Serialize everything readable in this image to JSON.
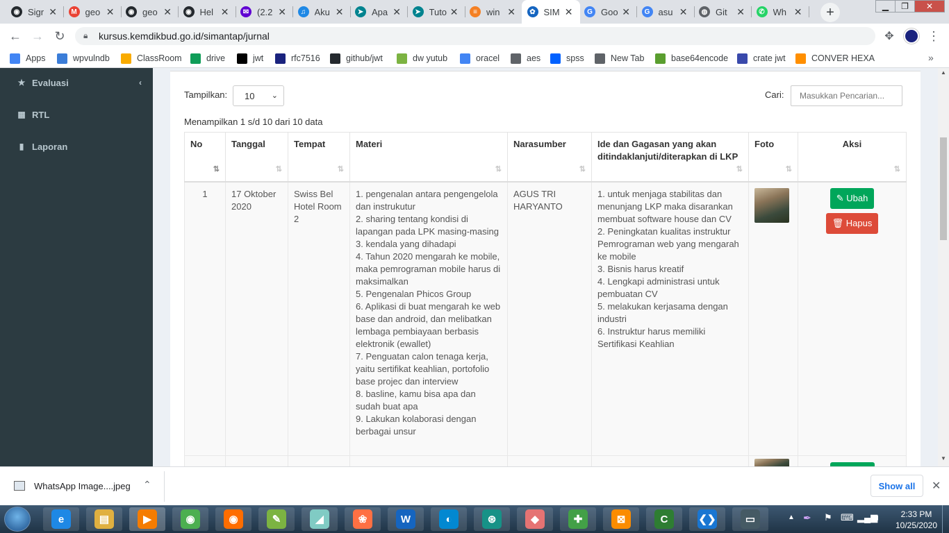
{
  "browser": {
    "tabs": [
      {
        "title": "Sigr",
        "icon": "github-icon",
        "color": "#24292e",
        "glyph": "◉"
      },
      {
        "title": "geo",
        "icon": "gmail-icon",
        "color": "#ea4335",
        "glyph": "M"
      },
      {
        "title": "geo",
        "icon": "github-icon",
        "color": "#24292e",
        "glyph": "◉"
      },
      {
        "title": "Hel",
        "icon": "github-icon",
        "color": "#24292e",
        "glyph": "◉"
      },
      {
        "title": "(2.2",
        "icon": "yahoo-mail-icon",
        "color": "#6001d2",
        "glyph": "✉"
      },
      {
        "title": "Aku",
        "icon": "document-icon",
        "color": "#1e88e5",
        "glyph": "♫"
      },
      {
        "title": "Apa",
        "icon": "web-icon",
        "color": "#00838f",
        "glyph": "➤"
      },
      {
        "title": "Tuto",
        "icon": "web-icon",
        "color": "#00838f",
        "glyph": "➤"
      },
      {
        "title": "win",
        "icon": "stackoverflow-icon",
        "color": "#f48024",
        "glyph": "≡"
      },
      {
        "title": "SIM",
        "icon": "kemdikbud-icon",
        "color": "#1565c0",
        "glyph": "✿",
        "active": true
      },
      {
        "title": "Goo",
        "icon": "google-docs-icon",
        "color": "#4285f4",
        "glyph": "G"
      },
      {
        "title": "asu",
        "icon": "google-icon",
        "color": "#4285f4",
        "glyph": "G"
      },
      {
        "title": "Git",
        "icon": "globe-icon",
        "color": "#5f6368",
        "glyph": "◍"
      },
      {
        "title": "Wh",
        "icon": "whatsapp-icon",
        "color": "#25d366",
        "glyph": "✆"
      }
    ],
    "url": "kursus.kemdikbud.go.id/simantap/jurnal",
    "bookmarks": [
      {
        "label": "Apps",
        "icon": "apps-grid-icon",
        "color": "#4285f4"
      },
      {
        "label": "wpvulndb",
        "icon": "wpvulndb-icon",
        "color": "#3b7dd8"
      },
      {
        "label": "ClassRoom",
        "icon": "classroom-icon",
        "color": "#f9ab00"
      },
      {
        "label": "drive",
        "icon": "drive-icon",
        "color": "#0f9d58"
      },
      {
        "label": "jwt",
        "icon": "jwt-icon",
        "color": "#000000"
      },
      {
        "label": "rfc7516",
        "icon": "rfc-icon",
        "color": "#1a237e"
      },
      {
        "label": "github/jwt",
        "icon": "github-icon",
        "color": "#24292e"
      },
      {
        "label": "dw yutub",
        "icon": "download-arrow-icon",
        "color": "#7cb342"
      },
      {
        "label": "oracel",
        "icon": "document-icon",
        "color": "#4285f4"
      },
      {
        "label": "aes",
        "icon": "globe-icon",
        "color": "#5f6368"
      },
      {
        "label": "spss",
        "icon": "dropbox-icon",
        "color": "#0061ff"
      },
      {
        "label": "New Tab",
        "icon": "globe-icon",
        "color": "#5f6368"
      },
      {
        "label": "base64encode",
        "icon": "b64-icon",
        "color": "#5a9e2f"
      },
      {
        "label": "crate jwt",
        "icon": "jwt-icon",
        "color": "#3949ab"
      },
      {
        "label": "CONVER HEXA",
        "icon": "hexa-icon",
        "color": "#ff8f00"
      }
    ]
  },
  "sidebar": {
    "items": [
      {
        "label": "Evaluasi",
        "icon": "star-icon",
        "glyph": "★"
      },
      {
        "label": "RTL",
        "icon": "table-icon",
        "glyph": "▦"
      },
      {
        "label": "Laporan",
        "icon": "file-icon",
        "glyph": "▮"
      }
    ]
  },
  "table_controls": {
    "show_label": "Tampilkan:",
    "show_value": "10",
    "search_label": "Cari:",
    "search_placeholder": "Masukkan Pencarian...",
    "info": "Menampilkan 1 s/d 10 dari 10 data"
  },
  "table": {
    "headers": [
      "No",
      "Tanggal",
      "Tempat",
      "Materi",
      "Narasumber",
      "Ide dan Gagasan yang akan ditindaklanjuti/diterapkan di LKP",
      "Foto",
      "Aksi"
    ],
    "rows": [
      {
        "no": "1",
        "tanggal": "17 Oktober 2020",
        "tempat": "Swiss Bel Hotel Room 2",
        "materi": [
          "1. pengenalan antara pengengelola dan instrukutur",
          "2. sharing tentang kondisi di lapangan pada LPK masing-masing",
          "3. kendala yang dihadapi",
          "4. Tahun 2020 mengarah ke mobile, maka pemrograman mobile harus di maksimalkan",
          "5. Pengenalan Phicos Group",
          "6. Aplikasi di buat mengarah ke web base dan android, dan melibatkan lembaga pembiayaan berbasis elektronik (ewallet)",
          "7. Penguatan calon tenaga kerja, yaitu sertifikat keahlian, portofolio base projec dan interview",
          "8. basline, kamu bisa apa dan sudah buat apa",
          "9. Lakukan kolaborasi dengan berbagai unsur"
        ],
        "narasumber": "AGUS TRI HARYANTO",
        "ide": [
          "1. untuk menjaga stabilitas dan menunjang LKP maka disarankan membuat software house dan CV",
          "2. Peningkatan kualitas instruktur Pemrograman web yang mengarah ke mobile",
          "3. Bisnis harus kreatif",
          "4. Lengkapi administrasi untuk pembuatan CV",
          "5. melakukan kerjasama dengan industri",
          "6. Instruktur harus memiliki Sertifikasi Keahlian"
        ],
        "btn_edit": "Ubah",
        "btn_delete": "Hapus"
      }
    ]
  },
  "downloads": {
    "file": "WhatsApp Image....jpeg",
    "show_all": "Show all"
  },
  "taskbar": {
    "time": "2:33 PM",
    "date": "10/25/2020",
    "apps": [
      "ie-icon",
      "explorer-icon",
      "media-player-icon",
      "chrome-icon",
      "firefox-icon",
      "notepad-plus-icon",
      "edit-icon",
      "uc-browser-icon",
      "word-icon",
      "edge-icon",
      "gitkraken-icon",
      "app-icon",
      "android-icon",
      "xampp-icon",
      "camtasia-icon",
      "vscode-icon",
      "terminal-icon"
    ]
  }
}
